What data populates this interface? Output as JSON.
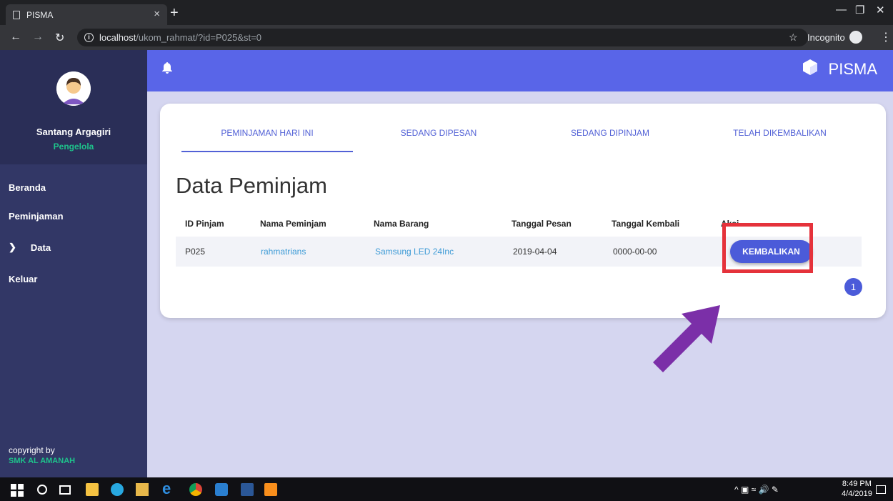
{
  "browser": {
    "tab_title": "PISMA",
    "tab_close": "×",
    "new_tab": "+",
    "url_host": "localhost",
    "url_path": "/ukom_rahmat/?id=P025&st=0",
    "incognito_label": "Incognito"
  },
  "sidebar": {
    "user_name": "Santang Argagiri",
    "user_role": "Pengelola",
    "menu": [
      {
        "label": "Beranda"
      },
      {
        "label": "Peminjaman"
      },
      {
        "label": "Data",
        "icon": "chevron-down-icon"
      },
      {
        "label": "Keluar"
      }
    ],
    "copyright_label": "copyright by",
    "copyright_org": "SMK AL AMANAH"
  },
  "topbar": {
    "brand": "PISMA",
    "bell_icon": "bell-icon",
    "logo_icon": "cube-icon"
  },
  "tabs": [
    {
      "label": "PEMINJAMAN HARI INI",
      "active": true
    },
    {
      "label": "SEDANG DIPESAN",
      "active": false
    },
    {
      "label": "SEDANG DIPINJAM",
      "active": false
    },
    {
      "label": "TELAH DIKEMBALIKAN",
      "active": false
    }
  ],
  "page_title": "Data Peminjam",
  "table": {
    "headers": [
      "ID Pinjam",
      "Nama Peminjam",
      "Nama Barang",
      "Tanggal Pesan",
      "Tanggal Kembali",
      "Aksi"
    ],
    "rows": [
      {
        "id": "P025",
        "nama_peminjam": "rahmatrians",
        "nama_barang": "Samsung LED 24Inc",
        "tanggal_pesan": "2019-04-04",
        "tanggal_kembali": "0000-00-00",
        "action_label": "KEMBALIKAN"
      }
    ]
  },
  "pagination": {
    "current_page": "1"
  },
  "colors": {
    "sidebar": "#323766",
    "topbar": "#5965e8",
    "accent": "#4b5bd9",
    "highlight": "#e5323b",
    "arrow": "#7b2fa8",
    "role": "#1ec28b"
  },
  "taskbar": {
    "time": "8:49 PM",
    "date": "4/4/2019"
  }
}
